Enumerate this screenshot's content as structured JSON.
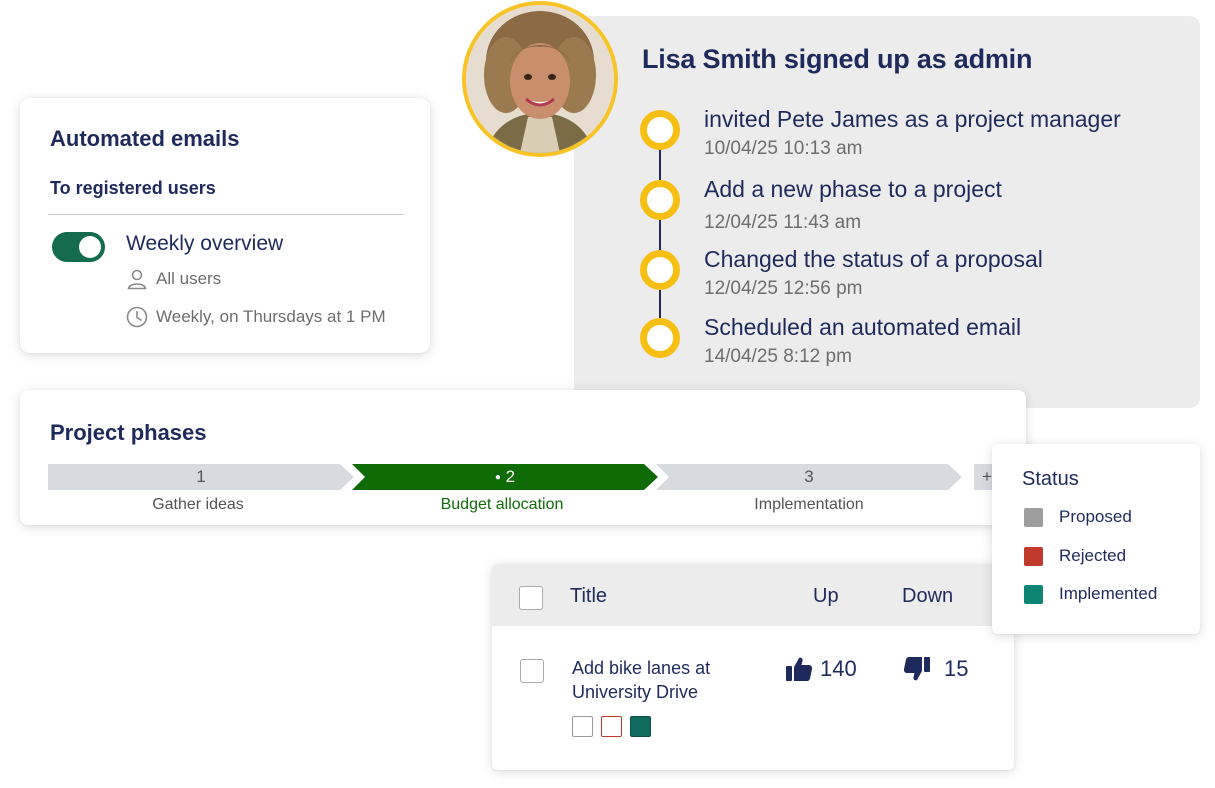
{
  "activity": {
    "title": "Lisa Smith signed up as admin",
    "items": [
      {
        "text": "invited Pete James as a project manager",
        "time": "10/04/25  10:13 am"
      },
      {
        "text": "Add a new phase to a project",
        "time": " 12/04/25  11:43 am"
      },
      {
        "text": "Changed the status of a proposal",
        "time": "12/04/25  12:56 pm"
      },
      {
        "text": "Scheduled an automated email",
        "time": "14/04/25  8:12 pm"
      }
    ],
    "accent_color": "#f7bf13"
  },
  "emails": {
    "title": "Automated emails",
    "subtitle": "To registered users",
    "item_name": "Weekly overview",
    "audience": "All users",
    "schedule": "Weekly, on Thursdays at 1 PM",
    "toggle_on": true,
    "toggle_color": "#146b4e"
  },
  "phases": {
    "title": "Project phases",
    "steps": [
      {
        "number": "1",
        "label": "Gather ideas",
        "active": false
      },
      {
        "number": "2",
        "label": "Budget allocation",
        "active": true
      },
      {
        "number": "3",
        "label": "Implementation",
        "active": false
      }
    ],
    "add_label": "+",
    "active_color": "#0e6b06",
    "inactive_color": "#d7dbe0"
  },
  "status": {
    "title": "Status",
    "items": [
      {
        "label": "Proposed",
        "color": "#9e9e9e"
      },
      {
        "label": "Rejected",
        "color": "#c0392b"
      },
      {
        "label": "Implemented",
        "color": "#0e8574"
      }
    ]
  },
  "table": {
    "columns": {
      "title": "Title",
      "up": "Up",
      "down": "Down"
    },
    "row": {
      "title": "Add bike lanes at University Drive",
      "up": "140",
      "down": "15"
    }
  }
}
